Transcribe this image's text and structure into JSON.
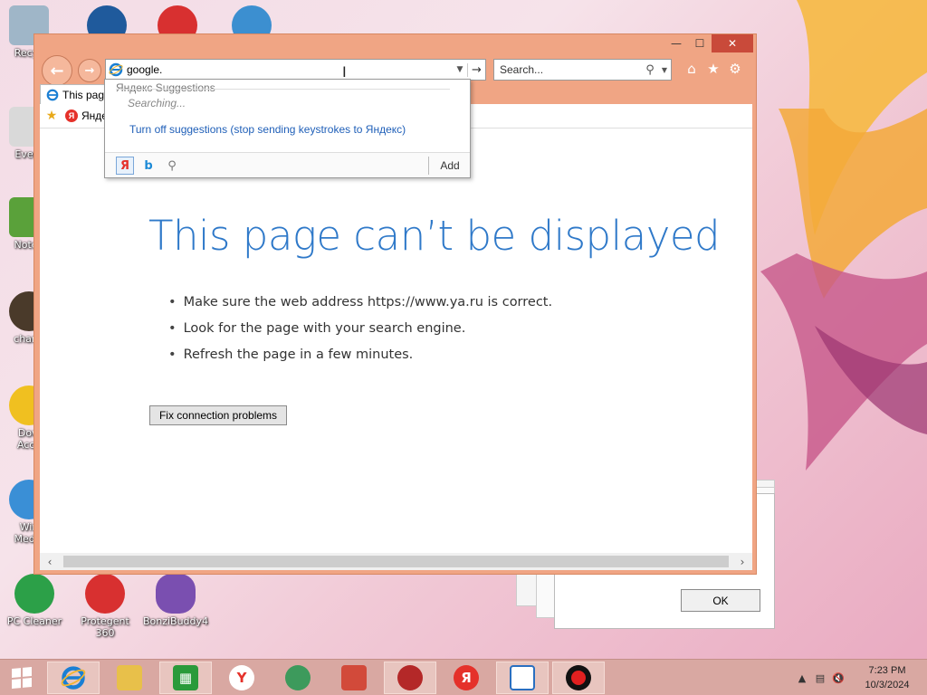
{
  "desktop": {
    "icons": [
      {
        "label": "Recyc",
        "color": "#9fb6c8"
      },
      {
        "label": "Every",
        "color": "#d9d9d9"
      },
      {
        "label": "Notep",
        "color": "#5aa13a"
      },
      {
        "label": "chang",
        "color": "#4a3a2a"
      },
      {
        "label": "Dow",
        "sub": "Acce",
        "color": "#f0c020"
      },
      {
        "label": "Win",
        "sub": "Media",
        "color": "#3a8fd6"
      },
      {
        "label": "PC Cleaner",
        "color": "#2ca048"
      },
      {
        "label": "Protegent 360",
        "color": "#d83030"
      },
      {
        "label": "BonziBuddy4",
        "color": "#7a4fb0"
      }
    ]
  },
  "dialog": {
    "ok_label": "OK"
  },
  "browser": {
    "address_value": "google.",
    "search_placeholder": "Search...",
    "tab_label": "This page can't be displayed",
    "fav_item_label": "Яндекс",
    "error": {
      "title": "This page can’t be displayed",
      "bullets": [
        "Make sure the web address https://www.ya.ru is correct.",
        "Look for the page with your search engine.",
        "Refresh the page in a few minutes."
      ],
      "fix_button": "Fix connection problems"
    },
    "suggestions": {
      "header": "Яндекс Suggestions",
      "status": "Searching...",
      "turn_off": "Turn off suggestions (stop sending keystrokes to Яндекс)",
      "add_label": "Add"
    }
  },
  "taskbar": {
    "time": "7:23 PM",
    "date": "10/3/2024"
  },
  "colors": {
    "window_frame": "#f0a584",
    "error_title": "#2f79c9",
    "link": "#1f5fb8",
    "taskbar": "#d9a8a2"
  }
}
